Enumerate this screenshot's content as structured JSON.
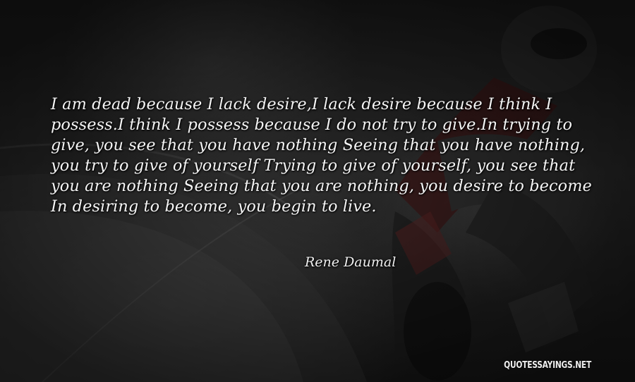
{
  "quote": {
    "text": "I am dead because I lack desire,I lack desire because I think I possess.I think I possess because I do not try to give.In trying to give, you see that you have nothing Seeing that you have nothing, you try to give of yourself Trying to give of yourself, you see that you are nothing Seeing that you are nothing, you desire to become In desiring to become, you begin to live.",
    "author": "Rene Daumal"
  },
  "watermark": "QUOTESSAYINGS.NET",
  "colors": {
    "text": "#f4f4f4",
    "background": "#1f1f1f"
  }
}
